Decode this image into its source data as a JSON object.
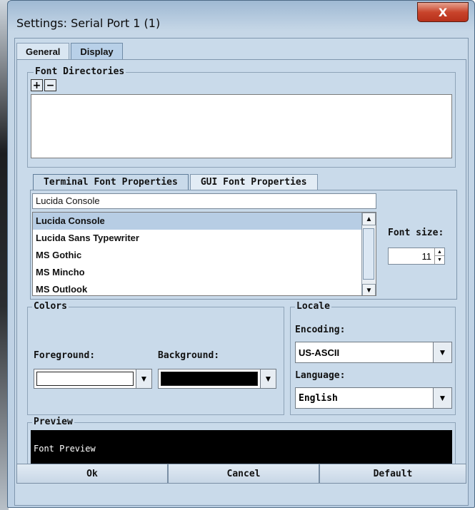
{
  "window": {
    "title": "Settings: Serial Port 1 (1)",
    "close_glyph": "X"
  },
  "tabs": [
    {
      "label": "General",
      "active": false
    },
    {
      "label": "Display",
      "active": true
    }
  ],
  "font_directories": {
    "legend": "Font Directories",
    "add_glyph": "+",
    "remove_glyph": "−"
  },
  "font_tabs": [
    {
      "label": "Terminal Font Properties",
      "active": true
    },
    {
      "label": "GUI Font Properties",
      "active": false
    }
  ],
  "font": {
    "field_value": "Lucida Console",
    "list": [
      {
        "name": "Lucida Console",
        "selected": true
      },
      {
        "name": "Lucida Sans Typewriter",
        "selected": false
      },
      {
        "name": "MS Gothic",
        "selected": false
      },
      {
        "name": "MS Mincho",
        "selected": false
      },
      {
        "name": "MS Outlook",
        "selected": false
      }
    ],
    "size_label": "Font size:",
    "size_value": "11"
  },
  "colors": {
    "legend": "Colors",
    "foreground_label": "Foreground:",
    "background_label": "Background:",
    "foreground_color": "#ffffff",
    "background_color": "#000000"
  },
  "locale": {
    "legend": "Locale",
    "encoding_label": "Encoding:",
    "encoding_value": "US-ASCII",
    "language_label": "Language:",
    "language_value": "English"
  },
  "preview": {
    "legend": "Preview",
    "text": "Font Preview"
  },
  "buttons": {
    "ok": "Ok",
    "cancel": "Cancel",
    "default": "Default"
  }
}
